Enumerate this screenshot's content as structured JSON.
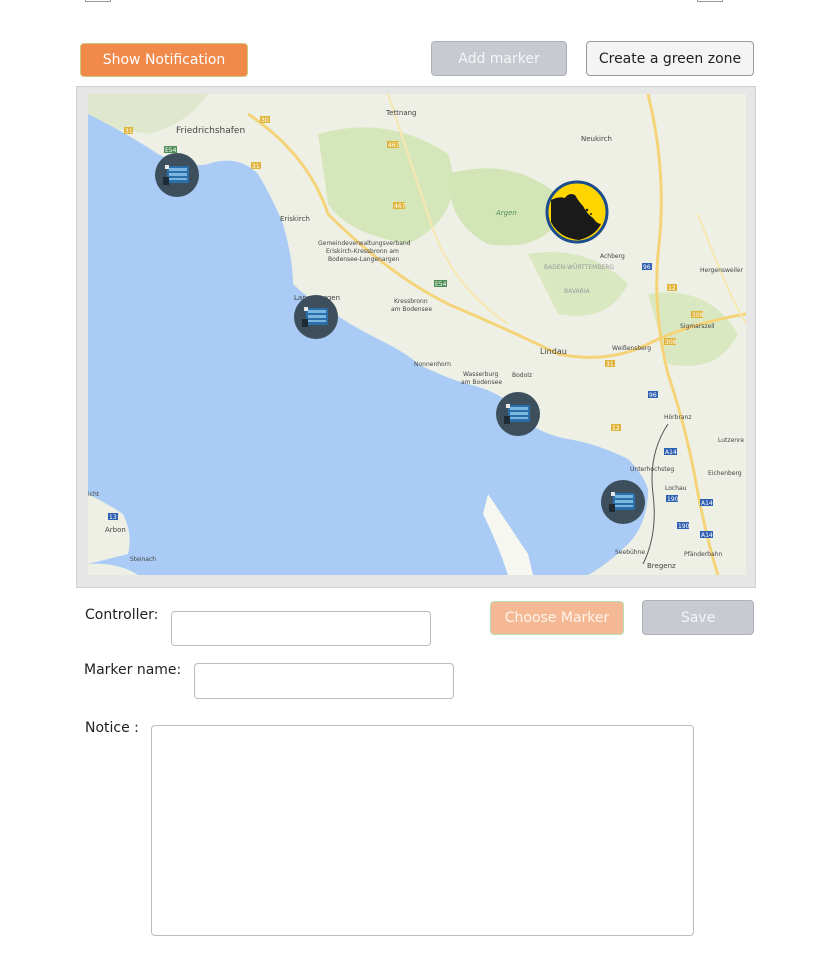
{
  "toolbar": {
    "show_notification": "Show Notification",
    "add_marker": "Add marker",
    "create_green_zone": "Create a green zone"
  },
  "map": {
    "place_labels": [
      "Friedrichshafen",
      "Tettnang",
      "Neukirch",
      "Eriskirch",
      "Argen",
      "Achberg",
      "Gemeindeverwaltungsverband",
      "Eriskirch-Kressbronn am",
      "Bodensee-Langenargen",
      "BADEN-WÜRTTEMBERG",
      "Hergensweiler",
      "BAVARIA",
      "Langenargen",
      "Kressbronn",
      "am Bodensee",
      "Sigmarszell",
      "Lindau",
      "Weißensberg",
      "Nonnenhorn",
      "Wasserburg",
      "am Bodensee",
      "Bodolz",
      "Hörbranz",
      "Lutzenre",
      "Unterhochsteg",
      "Eichenberg",
      "Lochau",
      "Arbon",
      "Steinach",
      "Seebühne",
      "Pfänderbahn",
      "Bregenz",
      "icht"
    ],
    "road_badges": [
      "31",
      "30",
      "E54",
      "31",
      "467",
      "467",
      "E54",
      "31",
      "308",
      "308",
      "12",
      "96",
      "96",
      "12",
      "A14",
      "A14",
      "190",
      "190",
      "A14",
      "13"
    ],
    "markers": {
      "device_icon": "server-device-icon",
      "zone_icon": "rock-shore-icon",
      "device_color": "#3d4f5c",
      "zone_yellow": "#ffd500",
      "zone_ring": "#1b4c8c"
    },
    "colors": {
      "water": "#a9cbf5",
      "land": "#eef0e6",
      "green": "#cfe3b1",
      "road": "#f5d479"
    }
  },
  "form": {
    "controller_label": "Controller:",
    "controller_value": "",
    "choose_marker": "Choose Marker",
    "save": "Save",
    "marker_name_label": "Marker name:",
    "marker_name_value": "",
    "notice_label": "Notice :",
    "notice_value": ""
  }
}
